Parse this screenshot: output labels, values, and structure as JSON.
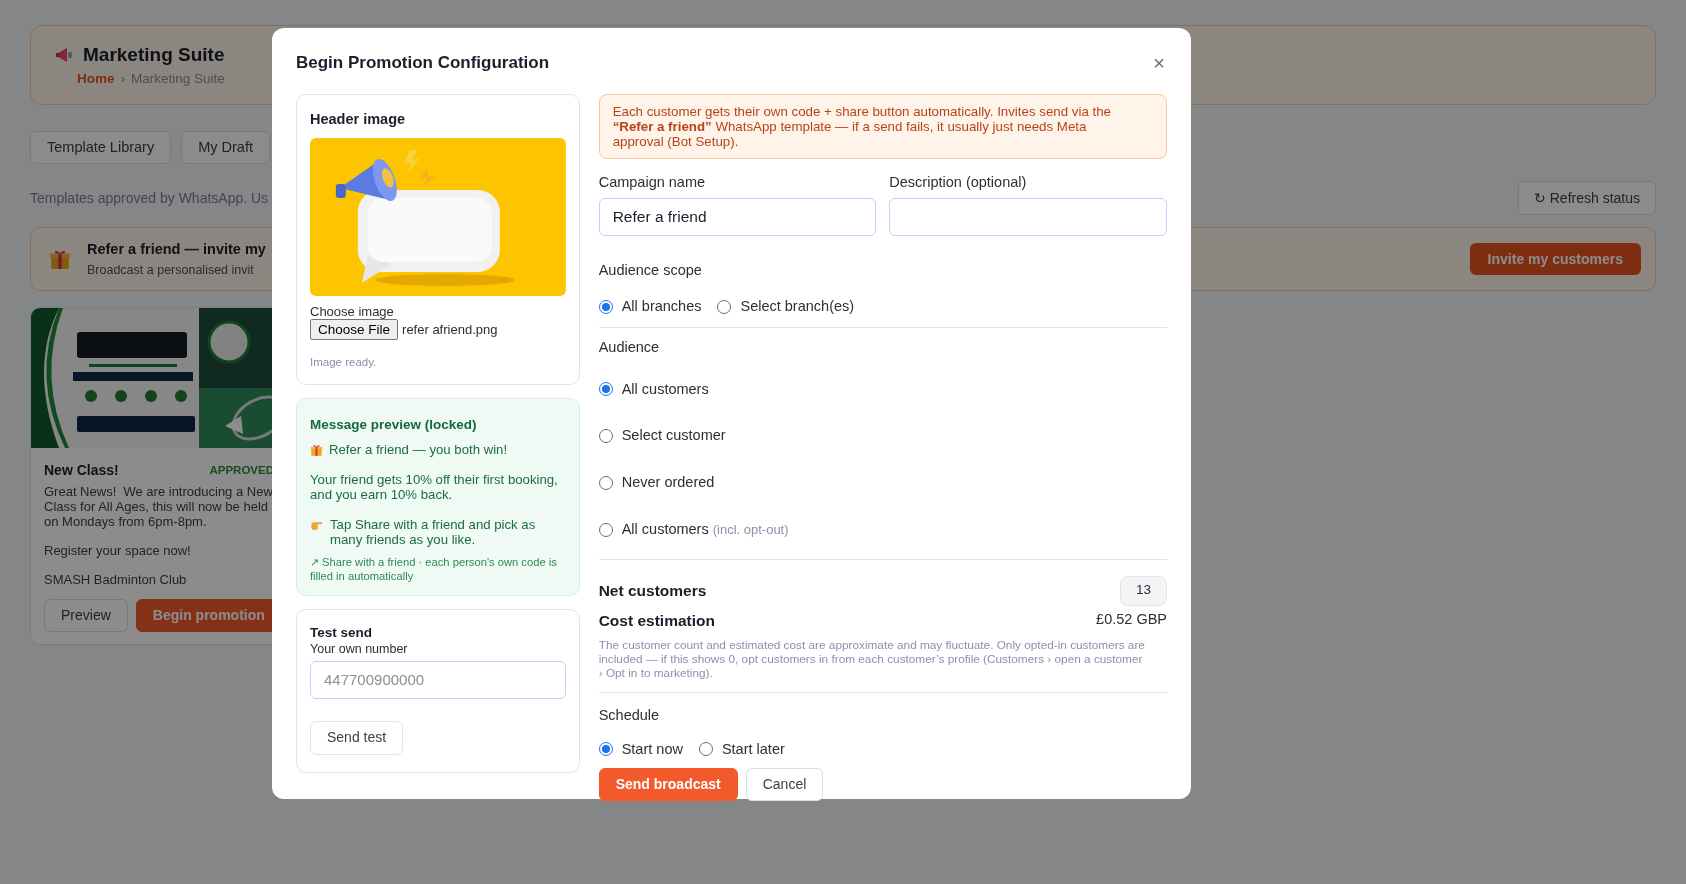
{
  "page": {
    "title": "Marketing Suite",
    "breadcrumb": [
      {
        "label": "Home",
        "current": false
      },
      {
        "label": "Marketing Suite",
        "current": true
      }
    ],
    "separator": "›"
  },
  "tabs": [
    {
      "label": "Template Library",
      "selected": false
    },
    {
      "label": "My Draft",
      "selected": false
    }
  ],
  "intro": "Templates approved by WhatsApp. Us",
  "refresh_button": "↻ Refresh status",
  "banner": {
    "title": "Refer a friend — invite my",
    "subtitle": "Broadcast a personalised invit",
    "button": "Invite my customers"
  },
  "template_card": {
    "image": {
      "kind": "picture"
    },
    "title": "New Class!",
    "status": "APPROVED",
    "body": [
      "Great News!  We are introducing a New Class for All Ages, this will now be held on Mondays from 6pm-8pm.",
      "Register your space now!",
      "SMASH Badminton Club"
    ],
    "buttons": [
      {
        "label": "Preview",
        "kind": "secondary"
      },
      {
        "label": "Begin promotion",
        "kind": "primary"
      }
    ]
  },
  "modal": {
    "title": "Begin Promotion Configuration",
    "close": "×",
    "header_image": {
      "title": "Header image",
      "image": {
        "kind": "picture"
      },
      "file_label": "Choose image",
      "file_button": "Choose File",
      "file_name": "refer afriend.png",
      "status": "Image ready."
    },
    "message_preview": {
      "title": "Message preview (locked)",
      "lines": [
        {
          "kind": "gift",
          "text": "Refer a friend — you both win!"
        },
        {
          "kind": "plain",
          "text": "Your friend gets 10% off their first booking, and you earn 10% back."
        },
        {
          "kind": "point",
          "text": "Tap Share with a friend and pick as many friends as you like."
        }
      ],
      "footnote": "↗ Share with a friend · each person's own code is filled in automatically"
    },
    "test_send": {
      "title": "Test send",
      "label": "Your own number",
      "placeholder": "447700900000",
      "button": "Send test"
    },
    "alert": "Each customer gets their own code + share button automatically. Invites send via the **“Refer a friend”** WhatsApp template — if a send fails, it usually just needs Meta approval (Bot Setup).",
    "campaign_name": {
      "label": "Campaign name",
      "value": "Refer a friend"
    },
    "description": {
      "label": "Description (optional)"
    },
    "audience_scope": {
      "label": "Audience scope",
      "options": [
        {
          "label": "All branches",
          "selected": true
        },
        {
          "label": "Select branch(es)",
          "selected": false
        }
      ]
    },
    "audience": {
      "label": "Audience",
      "options": [
        {
          "label": "All customers",
          "selected": true
        },
        {
          "label": "Select customer",
          "selected": false
        },
        {
          "label": "Never ordered",
          "selected": false
        },
        {
          "label": "All customers",
          "note": "(incl. opt-out)",
          "selected": false
        }
      ]
    },
    "net_customers": {
      "label": "Net customers",
      "value": "13"
    },
    "cost_estimation": {
      "label": "Cost estimation",
      "value": "£0.52 GBP",
      "note": "The customer count and estimated cost are approximate and may fluctuate. Only opted-in customers are included — if this shows 0, opt customers in from each customer’s profile (Customers › open a customer › Opt in to marketing)."
    },
    "schedule": {
      "label": "Schedule",
      "options": [
        {
          "label": "Start now",
          "selected": true
        },
        {
          "label": "Start later",
          "selected": false
        }
      ]
    },
    "buttons": [
      {
        "label": "Send broadcast",
        "kind": "primary"
      },
      {
        "label": "Cancel",
        "kind": "secondary"
      }
    ]
  }
}
